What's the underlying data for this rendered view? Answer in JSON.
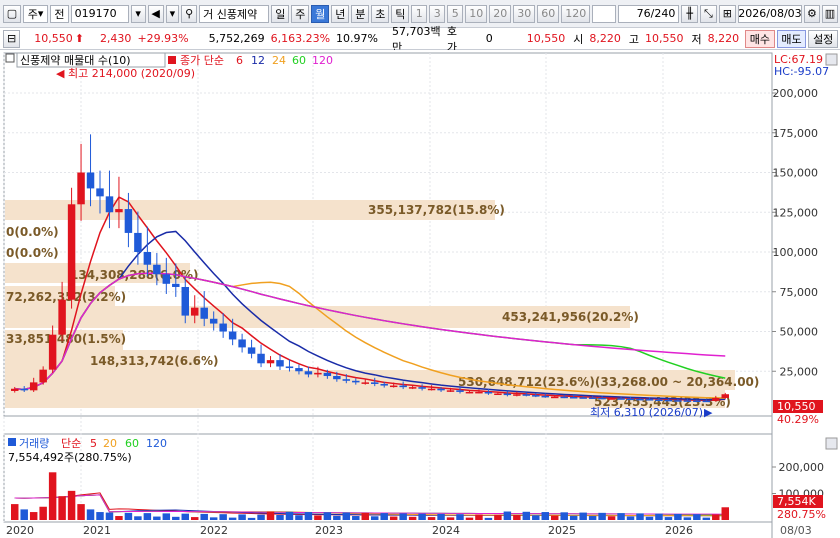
{
  "toolbar": {
    "window_icon": "window-icon",
    "market": "주",
    "scope": "전",
    "code": "019170",
    "sound_icon": "speaker-icon",
    "search_icon": "search-icon",
    "stock_prefix": "거",
    "stock_name": "신풍제약",
    "periods": [
      "일",
      "주",
      "월",
      "년",
      "분",
      "초",
      "틱"
    ],
    "active_period": "월",
    "intervals": [
      "1",
      "3",
      "5",
      "10",
      "20",
      "30",
      "60",
      "120"
    ],
    "count": "76",
    "count_total": "/240",
    "date": "2026/08/03"
  },
  "quote": {
    "price": "10,550",
    "change": "2,430",
    "change_pct": "+29.93%",
    "volume": "5,752,269",
    "volume_pct": "6,163.23%",
    "turnover": "10.97%",
    "amount": "57,703백만",
    "hoga_label": "호가",
    "hoga_value": "0",
    "ask": "10,550",
    "open_label": "시",
    "open": "8,220",
    "high_label": "고",
    "high": "10,550",
    "low_label": "저",
    "low": "8,220",
    "buy_label": "매수",
    "sell_label": "매도",
    "settings_label": "설정"
  },
  "legend": {
    "title": "신풍제약 매물대 수(10)",
    "ma_label": "종가 단순",
    "ma_periods": [
      "6",
      "12",
      "24",
      "60",
      "120"
    ],
    "lc": "LC:67.19",
    "hc": "HC:-95.07",
    "vol_label": "거래량",
    "vol_ma_label": "단순",
    "vol_periods": [
      "5",
      "20",
      "60",
      "120"
    ],
    "vol_value": "7,554,492주(280.75%)"
  },
  "annotations": {
    "high": "최고 214,000 (2020/09)",
    "low": "최저 6,310 (2026/07)",
    "price_tag": "10,550",
    "price_pct": "40.29%",
    "vol_tag": "7,554K",
    "vol_pct": "280.75%",
    "date_tag": "08/03"
  },
  "colors": {
    "up": "#e0141e",
    "down": "#1f5ad8",
    "ma6": "#e0141e",
    "ma12": "#1a2ca8",
    "ma24": "#f0a020",
    "ma60": "#22d022",
    "ma120": "#e020d0",
    "band": "#f5e2cc",
    "band_text": "#7a5a28"
  },
  "chart_data": {
    "type": "candlestick",
    "y_axis": {
      "ticks": [
        200000,
        175000,
        150000,
        125000,
        100000,
        75000,
        50000,
        25000
      ]
    },
    "volume_axis": {
      "ticks": [
        200000,
        100000
      ]
    },
    "x_axis": {
      "labels": [
        "2020",
        "2021",
        "2022",
        "2023",
        "2024",
        "2025",
        "2026"
      ]
    },
    "volume_profile": [
      {
        "label": "355,137,782(15.8%)"
      },
      {
        "label": "0(0.0%)"
      },
      {
        "label": "0(0.0%)"
      },
      {
        "label": "134,308,288(6.0%)"
      },
      {
        "label": "72,262,352(3.2%)"
      },
      {
        "label": "453,241,956(20.2%)"
      },
      {
        "label": "33,851,480(1.5%)"
      },
      {
        "label": "148,313,742(6.6%)"
      },
      {
        "label": "530,648,712(23.6%)(33,268.00 ~ 20,364.00)"
      },
      {
        "label": "523,453,443(23.3%)"
      }
    ]
  }
}
